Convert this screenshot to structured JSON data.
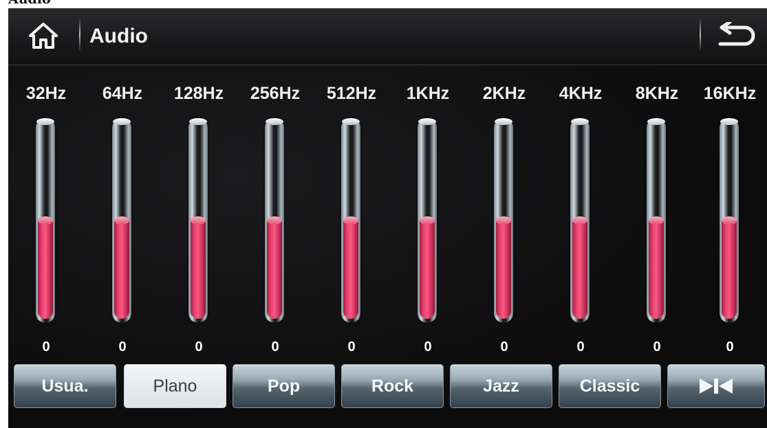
{
  "outer_label": "Audio",
  "header": {
    "title": "Audio",
    "home_icon": "home-icon",
    "back_icon": "back-arrow-icon"
  },
  "bands": [
    {
      "label": "32Hz",
      "value": "0",
      "level": 0.5
    },
    {
      "label": "64Hz",
      "value": "0",
      "level": 0.5
    },
    {
      "label": "128Hz",
      "value": "0",
      "level": 0.5
    },
    {
      "label": "256Hz",
      "value": "0",
      "level": 0.5
    },
    {
      "label": "512Hz",
      "value": "0",
      "level": 0.5
    },
    {
      "label": "1KHz",
      "value": "0",
      "level": 0.5
    },
    {
      "label": "2KHz",
      "value": "0",
      "level": 0.5
    },
    {
      "label": "4KHz",
      "value": "0",
      "level": 0.5
    },
    {
      "label": "8KHz",
      "value": "0",
      "level": 0.5
    },
    {
      "label": "16KHz",
      "value": "0",
      "level": 0.5
    }
  ],
  "presets": [
    {
      "label": "Usua.",
      "active": false
    },
    {
      "label": "Plano",
      "active": true
    },
    {
      "label": "Pop",
      "active": false
    },
    {
      "label": "Rock",
      "active": false
    },
    {
      "label": "Jazz",
      "active": false
    },
    {
      "label": "Classic",
      "active": false
    }
  ],
  "balance_icon": "balance-fader-icon",
  "colors": {
    "eq_fill": "#ef4672",
    "background": "#0d0d0e",
    "text": "#f0f0f0"
  }
}
